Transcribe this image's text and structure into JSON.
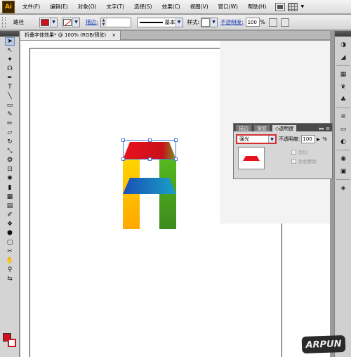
{
  "app": {
    "logo": "Ai"
  },
  "menu": {
    "items": [
      "文件(F)",
      "编辑(E)",
      "对象(O)",
      "文字(T)",
      "选择(S)",
      "效果(C)",
      "视图(V)",
      "窗口(W)",
      "帮助(H)"
    ]
  },
  "control_bar": {
    "object_type": "路径",
    "fill_color": "#d0101f",
    "stroke_label": "描边:",
    "stroke_profile": "基本",
    "style_label": "样式:",
    "opacity_label": "不透明度:",
    "opacity_value": "100",
    "opacity_unit": "%"
  },
  "document": {
    "tab_title": "折叠字体效果* @ 100% (RGB/预览)",
    "close_glyph": "×"
  },
  "artwork": {
    "colors": {
      "top": "#e8121e",
      "left_leg_top": "#ffd400",
      "left_leg_bottom": "#ffa800",
      "right_leg_top": "#56b81e",
      "right_leg_bottom": "#3d8a1e",
      "crossbar_left": "#1a4fb5",
      "crossbar_right": "#1aa0c8"
    }
  },
  "transparency_panel": {
    "tabs": [
      "描边",
      "渐变",
      "透明度"
    ],
    "active_tab": "透明度",
    "menu_glyph": "▸▸ ≡",
    "blend_mode": "强光",
    "opacity_label": "不透明度:",
    "opacity_value": "100",
    "opacity_unit": "%",
    "clip_label": "剪切",
    "invert_mask_label": "反相蒙版"
  },
  "watermark": {
    "text": "ARPUN"
  }
}
